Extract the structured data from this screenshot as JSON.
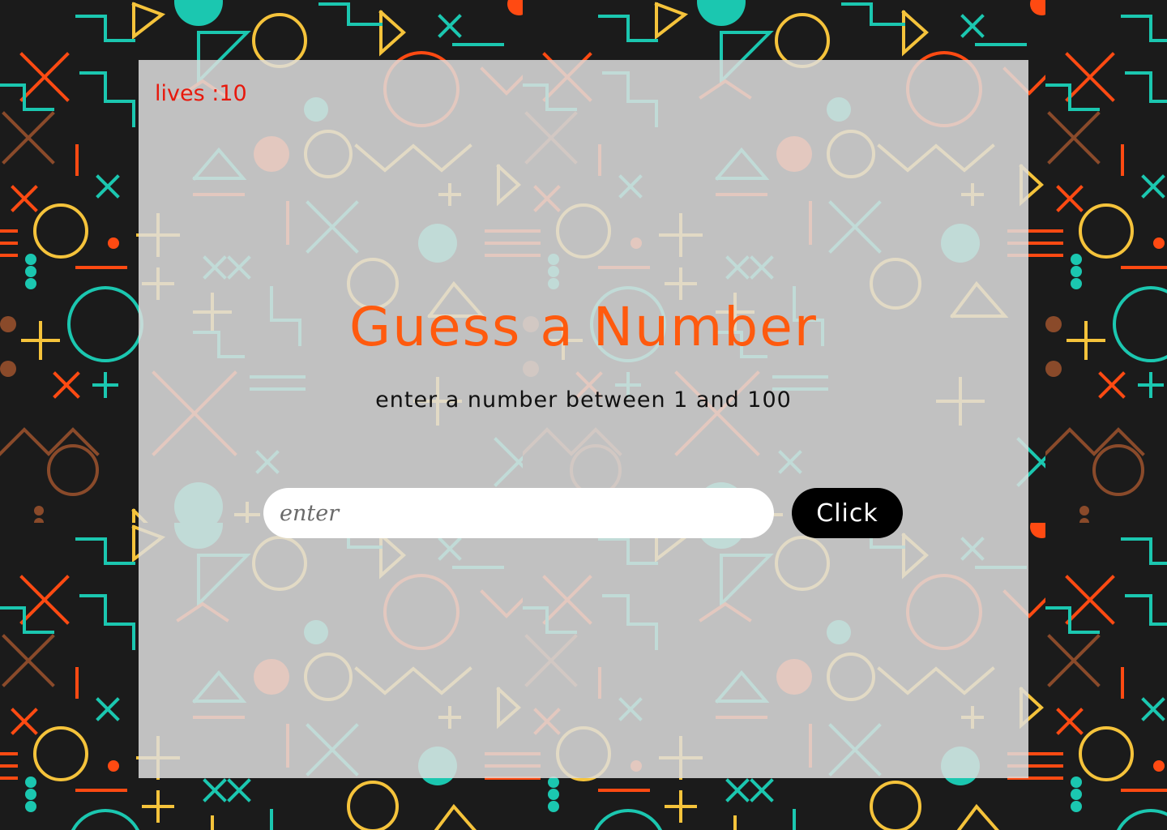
{
  "game": {
    "lives_label": "lives :",
    "lives_value": "10",
    "title": "Guess a Number",
    "instruction": "enter a number between 1 and 100",
    "input_placeholder": "enter",
    "input_value": "",
    "button_label": "Click"
  },
  "colors": {
    "background": "#1a1a1a",
    "card": "#dedede",
    "lives_text": "#e8180c",
    "title_text": "#ff5a0e",
    "button_bg": "#000000",
    "button_text": "#ffffff",
    "pattern": [
      "#1bc7b0",
      "#ff4a12",
      "#f5c33b",
      "#8a4a2a"
    ]
  }
}
